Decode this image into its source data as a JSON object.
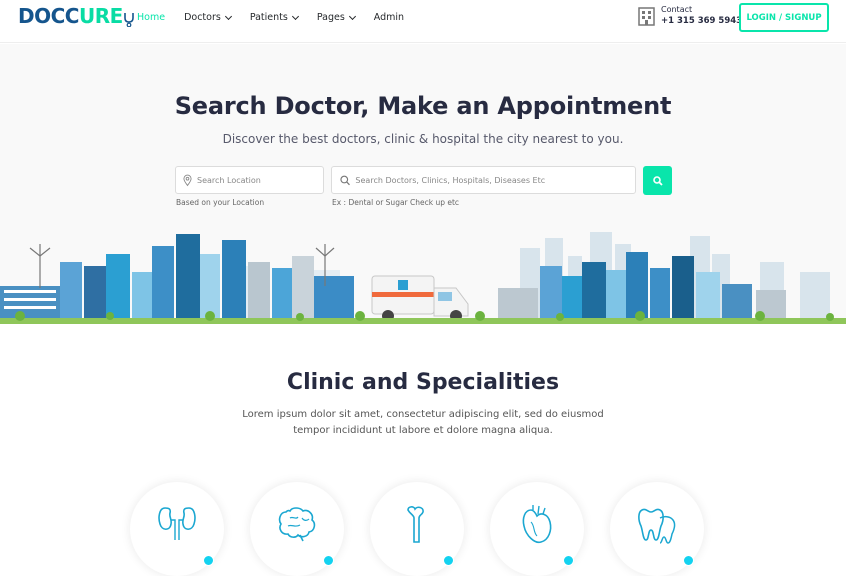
{
  "header": {
    "logo": {
      "part1": "DOCC",
      "part2": "URE"
    },
    "nav": [
      {
        "label": "Home",
        "active": true,
        "dropdown": false
      },
      {
        "label": "Doctors",
        "active": false,
        "dropdown": true
      },
      {
        "label": "Patients",
        "active": false,
        "dropdown": true
      },
      {
        "label": "Pages",
        "active": false,
        "dropdown": true
      },
      {
        "label": "Admin",
        "active": false,
        "dropdown": false
      }
    ],
    "contact": {
      "label": "Contact",
      "phone": "+1 315 369 5943",
      "icon": "hospital-building-icon"
    },
    "login_label": "LOGIN / SIGNUP"
  },
  "hero": {
    "title": "Search Doctor, Make an Appointment",
    "subtitle": "Discover the best doctors, clinic & hospital the city nearest to you.",
    "location_placeholder": "Search Location",
    "search_placeholder": "Search Doctors, Clinics, Hospitals, Diseases Etc",
    "location_hint": "Based on your Location",
    "search_hint": "Ex : Dental or Sugar Check up etc"
  },
  "section": {
    "title": "Clinic and Specialities",
    "desc_line1": "Lorem ipsum dolor sit amet, consectetur adipiscing elit, sed do eiusmod",
    "desc_line2": "tempor incididunt ut labore et dolore magna aliqua."
  },
  "specialities": [
    {
      "icon": "kidney-icon"
    },
    {
      "icon": "brain-icon"
    },
    {
      "icon": "bone-icon"
    },
    {
      "icon": "heart-icon"
    },
    {
      "icon": "tooth-icon"
    }
  ],
  "colors": {
    "accent": "#09e5ab",
    "brand": "#15558d",
    "dot": "#13d2f0"
  }
}
